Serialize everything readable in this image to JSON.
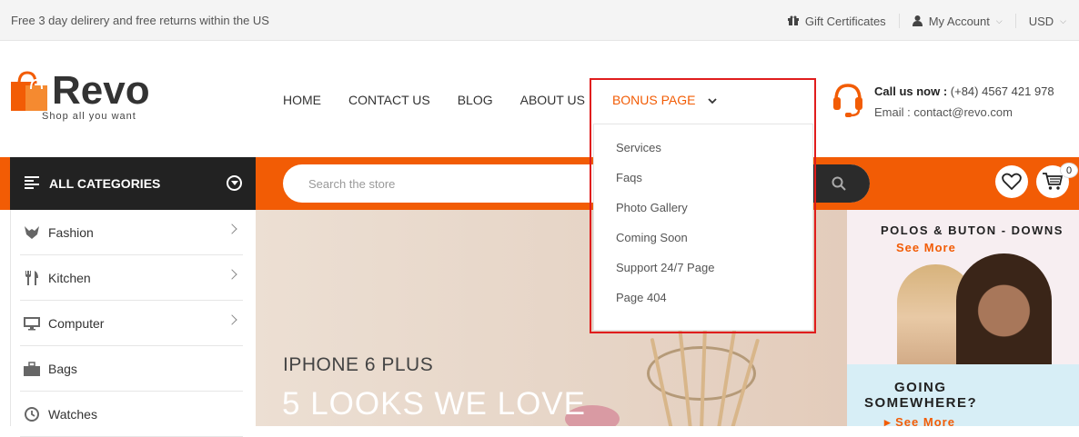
{
  "topbar": {
    "promo": "Free 3 day delirery and free returns within the US",
    "gift": "Gift Certificates",
    "account": "My Account",
    "currency": "USD"
  },
  "logo": {
    "name": "Revo",
    "tagline": "Shop all you want"
  },
  "nav": {
    "items": [
      "HOME",
      "CONTACT US",
      "BLOG",
      "ABOUT US",
      "BONUS PAGE"
    ]
  },
  "dropdown": {
    "items": [
      "Services",
      "Faqs",
      "Photo Gallery",
      "Coming Soon",
      "Support 24/7 Page",
      "Page 404"
    ]
  },
  "contact": {
    "call_label": "Call us now :",
    "call_value": " (+84) 4567 421 978",
    "email": "Email : contact@revo.com"
  },
  "categories": {
    "header": "ALL CATEGORIES",
    "items": [
      "Fashion",
      "Kitchen",
      "Computer",
      "Bags",
      "Watches"
    ]
  },
  "search": {
    "placeholder": "Search the store"
  },
  "cart": {
    "count": "0"
  },
  "banner": {
    "small": "IPHONE 6 PLUS",
    "big": "5 LOOKS WE LOVE"
  },
  "promo1": {
    "title": "POLOS & BUTON - DOWNS",
    "link": "See More"
  },
  "promo2": {
    "line1": "GOING",
    "line2": "SOMEWHERE?",
    "link": "▸ See More"
  },
  "colors": {
    "accent": "#f25c05",
    "dark": "#222222",
    "highlight_box": "#e01d1d"
  }
}
